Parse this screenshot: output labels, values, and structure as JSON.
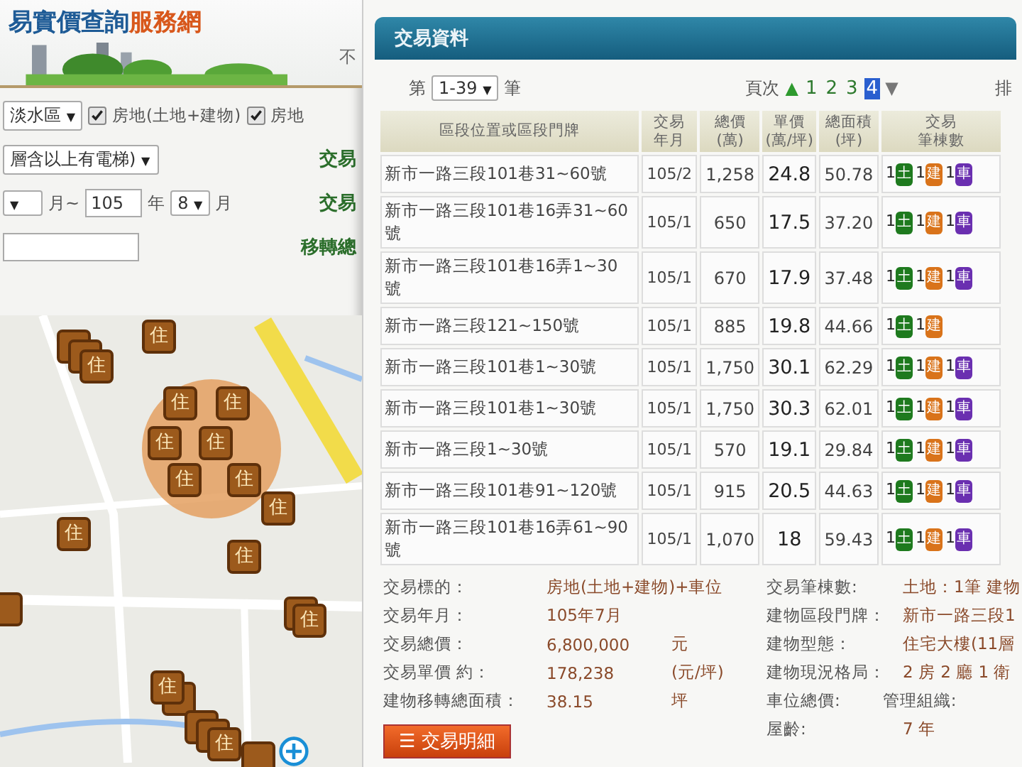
{
  "site": {
    "title_main": "易實價查詢",
    "title_accent": "服務網",
    "side_text": "不"
  },
  "search_form": {
    "district": "淡水區",
    "checkboxes": [
      {
        "label": "房地(土地+建物)",
        "checked": true
      },
      {
        "label": "房地",
        "checked": true
      }
    ],
    "caret": "▼",
    "building_type": "層含以上有電梯)",
    "month_from_label": "月~",
    "year_to": "105",
    "year_label": "年",
    "month_to": "8",
    "month_label": "月",
    "side_labels": [
      "交易",
      "交易",
      "移轉總"
    ]
  },
  "map": {
    "markers": [
      {
        "label": "住"
      },
      {
        "label": "住"
      },
      {
        "label": "住"
      },
      {
        "label": "住"
      },
      {
        "label": "住"
      },
      {
        "label": "住"
      },
      {
        "label": "住"
      },
      {
        "label": "住"
      },
      {
        "label": "住"
      },
      {
        "label": "住"
      },
      {
        "label": "住"
      },
      {
        "label": "住"
      },
      {
        "label": "住"
      },
      {
        "label": "住"
      }
    ]
  },
  "panel": {
    "title": "交易資料",
    "range": {
      "prefix": "第",
      "value": "1-39",
      "caret": "▼",
      "suffix": "筆"
    },
    "pager": {
      "label": "頁次",
      "prev": "▲",
      "next": "▼",
      "pages": [
        {
          "label": "1",
          "selected": false
        },
        {
          "label": "2",
          "selected": false
        },
        {
          "label": "3",
          "selected": false
        },
        {
          "label": "4",
          "selected": true
        }
      ]
    },
    "sort_label": "排",
    "table": {
      "columns": [
        {
          "lines": [
            "區段位置或區段門牌"
          ]
        },
        {
          "lines": [
            "交易",
            "年月"
          ]
        },
        {
          "lines": [
            "總價",
            "(萬)"
          ]
        },
        {
          "lines": [
            "單價",
            "(萬/坪)"
          ]
        },
        {
          "lines": [
            "總面積",
            "(坪)"
          ]
        },
        {
          "lines": [
            "交易",
            "筆棟數"
          ]
        }
      ],
      "rows": [
        {
          "address": "新市一路三段101巷31~60號",
          "date": "105/2",
          "total": "1,258",
          "unit": "24.8",
          "area": "50.78",
          "counts": [
            {
              "count": "1",
              "label": "土",
              "color": "#1e7a1e"
            },
            {
              "count": "1",
              "label": "建",
              "color": "#d9731a"
            },
            {
              "count": "1",
              "label": "車",
              "color": "#6a2fb0"
            }
          ]
        },
        {
          "address": "新市一路三段101巷16弄31~60號",
          "date": "105/1",
          "total": "650",
          "unit": "17.5",
          "area": "37.20",
          "counts": [
            {
              "count": "1",
              "label": "土",
              "color": "#1e7a1e"
            },
            {
              "count": "1",
              "label": "建",
              "color": "#d9731a"
            },
            {
              "count": "1",
              "label": "車",
              "color": "#6a2fb0"
            }
          ]
        },
        {
          "address": "新市一路三段101巷16弄1~30號",
          "date": "105/1",
          "total": "670",
          "unit": "17.9",
          "area": "37.48",
          "counts": [
            {
              "count": "1",
              "label": "土",
              "color": "#1e7a1e"
            },
            {
              "count": "1",
              "label": "建",
              "color": "#d9731a"
            },
            {
              "count": "1",
              "label": "車",
              "color": "#6a2fb0"
            }
          ]
        },
        {
          "address": "新市一路三段121~150號",
          "date": "105/1",
          "total": "885",
          "unit": "19.8",
          "area": "44.66",
          "counts": [
            {
              "count": "1",
              "label": "土",
              "color": "#1e7a1e"
            },
            {
              "count": "1",
              "label": "建",
              "color": "#d9731a"
            }
          ]
        },
        {
          "address": "新市一路三段101巷1~30號",
          "date": "105/1",
          "total": "1,750",
          "unit": "30.1",
          "area": "62.29",
          "counts": [
            {
              "count": "1",
              "label": "土",
              "color": "#1e7a1e"
            },
            {
              "count": "1",
              "label": "建",
              "color": "#d9731a"
            },
            {
              "count": "1",
              "label": "車",
              "color": "#6a2fb0"
            }
          ]
        },
        {
          "address": "新市一路三段101巷1~30號",
          "date": "105/1",
          "total": "1,750",
          "unit": "30.3",
          "area": "62.01",
          "counts": [
            {
              "count": "1",
              "label": "土",
              "color": "#1e7a1e"
            },
            {
              "count": "1",
              "label": "建",
              "color": "#d9731a"
            },
            {
              "count": "1",
              "label": "車",
              "color": "#6a2fb0"
            }
          ]
        },
        {
          "address": "新市一路三段1~30號",
          "date": "105/1",
          "total": "570",
          "unit": "19.1",
          "area": "29.84",
          "counts": [
            {
              "count": "1",
              "label": "土",
              "color": "#1e7a1e"
            },
            {
              "count": "1",
              "label": "建",
              "color": "#d9731a"
            },
            {
              "count": "1",
              "label": "車",
              "color": "#6a2fb0"
            }
          ]
        },
        {
          "address": "新市一路三段101巷91~120號",
          "date": "105/1",
          "total": "915",
          "unit": "20.5",
          "area": "44.63",
          "counts": [
            {
              "count": "1",
              "label": "土",
              "color": "#1e7a1e"
            },
            {
              "count": "1",
              "label": "建",
              "color": "#d9731a"
            },
            {
              "count": "1",
              "label": "車",
              "color": "#6a2fb0"
            }
          ]
        },
        {
          "address": "新市一路三段101巷16弄61~90號",
          "date": "105/1",
          "total": "1,070",
          "unit": "18",
          "area": "59.43",
          "counts": [
            {
              "count": "1",
              "label": "土",
              "color": "#1e7a1e"
            },
            {
              "count": "1",
              "label": "建",
              "color": "#d9731a"
            },
            {
              "count": "1",
              "label": "車",
              "color": "#6a2fb0"
            }
          ]
        }
      ]
    },
    "details_left": [
      {
        "label": "交易標的：",
        "value": "房地(土地+建物)+車位"
      },
      {
        "label": "交易年月：",
        "value": "105年7月"
      },
      {
        "label": "交易總價：",
        "value": "6,800,000",
        "unit": "元"
      },
      {
        "label": "交易單價 約：",
        "value": "178,238",
        "unit": "(元/坪)"
      },
      {
        "label": "建物移轉總面積：",
        "value": "38.15",
        "unit": "坪"
      }
    ],
    "details_button": {
      "icon": "☰",
      "label": "交易明細"
    },
    "details_right": [
      {
        "label": "交易筆棟數:",
        "value": "土地：1筆 建物"
      },
      {
        "label": "建物區段門牌：",
        "value": "新市一路三段1"
      },
      {
        "label": "建物型態：",
        "value": "住宅大樓(11層"
      },
      {
        "label": "建物現況格局：",
        "value": "2 房 2 廳 1 衛"
      },
      {
        "label": "車位總價:",
        "extra_label": "管理組織:"
      },
      {
        "label": "屋齡:",
        "value": "7 年"
      }
    ]
  }
}
